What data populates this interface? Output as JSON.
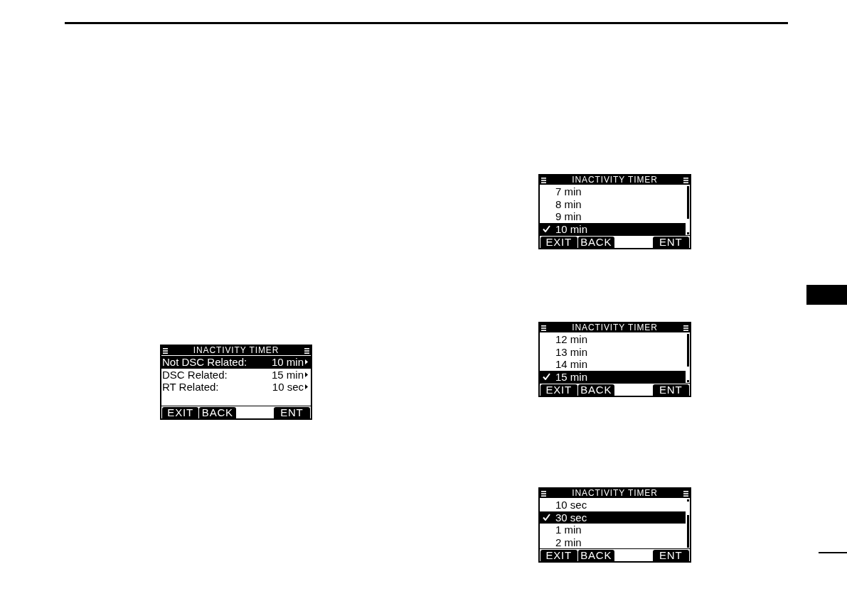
{
  "left_column": {
    "screens": [
      {
        "kind": "menu",
        "title": "INACTIVITY TIMER",
        "rows": [
          {
            "label": "Not DSC Related:",
            "value": "10 min",
            "selected": true
          },
          {
            "label": "DSC Related:",
            "value": "15 min",
            "selected": false
          },
          {
            "label": "RT Related:",
            "value": "10 sec",
            "selected": false
          }
        ],
        "softkeys": [
          "EXIT",
          "BACK",
          "ENT"
        ]
      }
    ]
  },
  "right_column": {
    "screens": [
      {
        "kind": "options",
        "title": "INACTIVITY TIMER",
        "rows": [
          {
            "label": "7 min",
            "selected": false,
            "checked": false
          },
          {
            "label": "8 min",
            "selected": false,
            "checked": false
          },
          {
            "label": "9 min",
            "selected": false,
            "checked": false
          },
          {
            "label": "10 min",
            "selected": true,
            "checked": true
          }
        ],
        "softkeys": [
          "EXIT",
          "BACK",
          "ENT"
        ]
      },
      {
        "kind": "options",
        "title": "INACTIVITY TIMER",
        "rows": [
          {
            "label": "12 min",
            "selected": false,
            "checked": false
          },
          {
            "label": "13 min",
            "selected": false,
            "checked": false
          },
          {
            "label": "14 min",
            "selected": false,
            "checked": false
          },
          {
            "label": "15 min",
            "selected": true,
            "checked": true
          }
        ],
        "softkeys": [
          "EXIT",
          "BACK",
          "ENT"
        ]
      },
      {
        "kind": "options",
        "title": "INACTIVITY TIMER",
        "rows": [
          {
            "label": "10 sec",
            "selected": false,
            "checked": false
          },
          {
            "label": "30 sec",
            "selected": true,
            "checked": true
          },
          {
            "label": "1 min",
            "selected": false,
            "checked": false
          },
          {
            "label": "2 min",
            "selected": false,
            "checked": false
          }
        ],
        "softkeys": [
          "EXIT",
          "BACK",
          "ENT"
        ]
      }
    ]
  }
}
